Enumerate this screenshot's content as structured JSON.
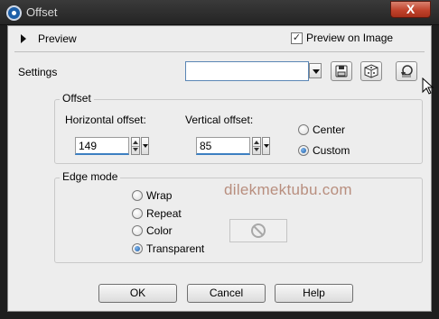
{
  "window": {
    "title": "Offset",
    "close_label": "X"
  },
  "preview": {
    "label": "Preview",
    "preview_on_image_label": "Preview on Image",
    "preview_on_image_checked": true
  },
  "settings": {
    "label": "Settings",
    "value": ""
  },
  "offset_group": {
    "legend": "Offset",
    "horizontal_label": "Horizontal offset:",
    "horizontal_value": "149",
    "vertical_label": "Vertical offset:",
    "vertical_value": "85",
    "options": [
      {
        "label": "Center",
        "selected": false
      },
      {
        "label": "Custom",
        "selected": true
      }
    ]
  },
  "edge_group": {
    "legend": "Edge mode",
    "options": [
      {
        "label": "Wrap",
        "selected": false
      },
      {
        "label": "Repeat",
        "selected": false
      },
      {
        "label": "Color",
        "selected": false
      },
      {
        "label": "Transparent",
        "selected": true
      }
    ]
  },
  "watermark": "dilekmektubu.com",
  "buttons": {
    "ok": "OK",
    "cancel": "Cancel",
    "help": "Help"
  }
}
